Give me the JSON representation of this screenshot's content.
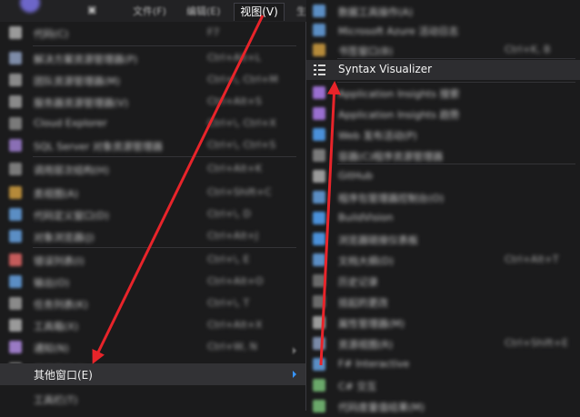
{
  "menubar": {
    "items": [
      "文件(F)",
      "编辑(E)",
      "视图(V)",
      "生"
    ],
    "active": "视图(V)"
  },
  "view_menu": {
    "items": [
      {
        "label": "代码(C)",
        "shortcut": "F7",
        "icon": "code-icon",
        "color": "#9a9a9a"
      },
      {
        "label": "解决方案资源管理器(P)",
        "shortcut": "Ctrl+Alt+L",
        "icon": "solution-explorer-icon",
        "color": "#7e8ca8"
      },
      {
        "label": "团队资源管理器(M)",
        "shortcut": "Ctrl+\\, Ctrl+M",
        "icon": "team-explorer-icon",
        "color": "#8a8a8a"
      },
      {
        "label": "服务器资源管理器(V)",
        "shortcut": "Ctrl+Alt+S",
        "icon": "server-explorer-icon",
        "color": "#8a8a8a"
      },
      {
        "label": "Cloud Explorer",
        "shortcut": "Ctrl+\\, Ctrl+X",
        "icon": "cloud-explorer-icon",
        "color": "#7a7a7a"
      },
      {
        "label": "SQL Server 对象资源管理器",
        "shortcut": "Ctrl+\\, Ctrl+S",
        "icon": "sql-server-icon",
        "color": "#8a6fb5"
      },
      {
        "label": "调用层次结构(H)",
        "shortcut": "Ctrl+Alt+K",
        "icon": "call-hierarchy-icon",
        "color": "#7a7a7a"
      },
      {
        "label": "类视图(A)",
        "shortcut": "Ctrl+Shift+C",
        "icon": "class-view-icon",
        "color": "#b58a3a"
      },
      {
        "label": "代码定义窗口(D)",
        "shortcut": "Ctrl+\\, D",
        "icon": "code-definition-icon",
        "color": "#5b8ec4"
      },
      {
        "label": "对象浏览器(J)",
        "shortcut": "Ctrl+Alt+J",
        "icon": "object-browser-icon",
        "color": "#5b8ec4"
      },
      {
        "label": "错误列表(I)",
        "shortcut": "Ctrl+\\, E",
        "icon": "error-list-icon",
        "color": "#c45b5b"
      },
      {
        "label": "输出(O)",
        "shortcut": "Ctrl+Alt+O",
        "icon": "output-icon",
        "color": "#5b8ec4"
      },
      {
        "label": "任务列表(K)",
        "shortcut": "Ctrl+\\, T",
        "icon": "task-list-icon",
        "color": "#8a8a8a"
      },
      {
        "label": "工具箱(X)",
        "shortcut": "Ctrl+Alt+X",
        "icon": "toolbox-icon",
        "color": "#9a9a9a"
      },
      {
        "label": "通知(N)",
        "shortcut": "Ctrl+W, N",
        "icon": "notifications-icon",
        "color": "#9a7ac4"
      },
      {
        "label": "终端窗口(R)",
        "shortcut": "",
        "icon": "terminal-icon",
        "color": "#7a7a7a"
      }
    ],
    "other_windows": "其他窗口(E)",
    "toolbars": "工具栏(T)"
  },
  "other_windows_menu": {
    "items": [
      {
        "label": "数据工具操作(A)",
        "shortcut": "",
        "icon": "data-tools-icon",
        "color": "#5b8ec4"
      },
      {
        "label": "Microsoft Azure 活动日志",
        "shortcut": "",
        "icon": "azure-log-icon",
        "color": "#5b8ec4"
      },
      {
        "label": "书签窗口(B)",
        "shortcut": "Ctrl+K, B",
        "icon": "bookmark-icon",
        "color": "#b58a3a"
      },
      {
        "label": "Syntax Visualizer",
        "shortcut": "",
        "icon": "syntax-visualizer-icon",
        "color": "#d8d8d8"
      },
      {
        "label": "Application Insights 搜索",
        "shortcut": "",
        "icon": "app-insights-search-icon",
        "color": "#9a6fd0"
      },
      {
        "label": "Application Insights 趋势",
        "shortcut": "",
        "icon": "app-insights-trends-icon",
        "color": "#9a6fd0"
      },
      {
        "label": "Web 发布活动(P)",
        "shortcut": "",
        "icon": "web-publish-icon",
        "color": "#4a90d9"
      },
      {
        "label": "容器(C)程序资源管理器",
        "shortcut": "",
        "icon": "container-icon",
        "color": "#7a7a7a"
      },
      {
        "label": "GitHub",
        "shortcut": "",
        "icon": "github-icon",
        "color": "#9a9a9a"
      },
      {
        "label": "程序包管理器控制台(O)",
        "shortcut": "",
        "icon": "package-console-icon",
        "color": "#5b8ec4"
      },
      {
        "label": "BuildVision",
        "shortcut": "",
        "icon": "buildvision-icon",
        "color": "#4a90d9"
      },
      {
        "label": "浏览器链接仪表板",
        "shortcut": "",
        "icon": "browser-link-icon",
        "color": "#4a90d9"
      },
      {
        "label": "文档大纲(D)",
        "shortcut": "Ctrl+Alt+T",
        "icon": "document-outline-icon",
        "color": "#5b8ec4"
      },
      {
        "label": "历史记录",
        "shortcut": "",
        "icon": "history-icon",
        "color": "#6a6a6a"
      },
      {
        "label": "挂起的更改",
        "shortcut": "",
        "icon": "pending-changes-icon",
        "color": "#6a6a6a"
      },
      {
        "label": "属性管理器(M)",
        "shortcut": "",
        "icon": "property-manager-icon",
        "color": "#9a9a9a"
      },
      {
        "label": "资源视图(R)",
        "shortcut": "Ctrl+Shift+E",
        "icon": "resource-view-icon",
        "color": "#7a8aa8"
      },
      {
        "label": "F# Interactive",
        "shortcut": "",
        "icon": "fsharp-icon",
        "color": "#5b8ec4"
      },
      {
        "label": "C# 交互",
        "shortcut": "",
        "icon": "csharp-interactive-icon",
        "color": "#6aa86a"
      },
      {
        "label": "代码度量值结果(M)",
        "shortcut": "",
        "icon": "code-metrics-icon",
        "color": "#6aa86a"
      }
    ]
  }
}
